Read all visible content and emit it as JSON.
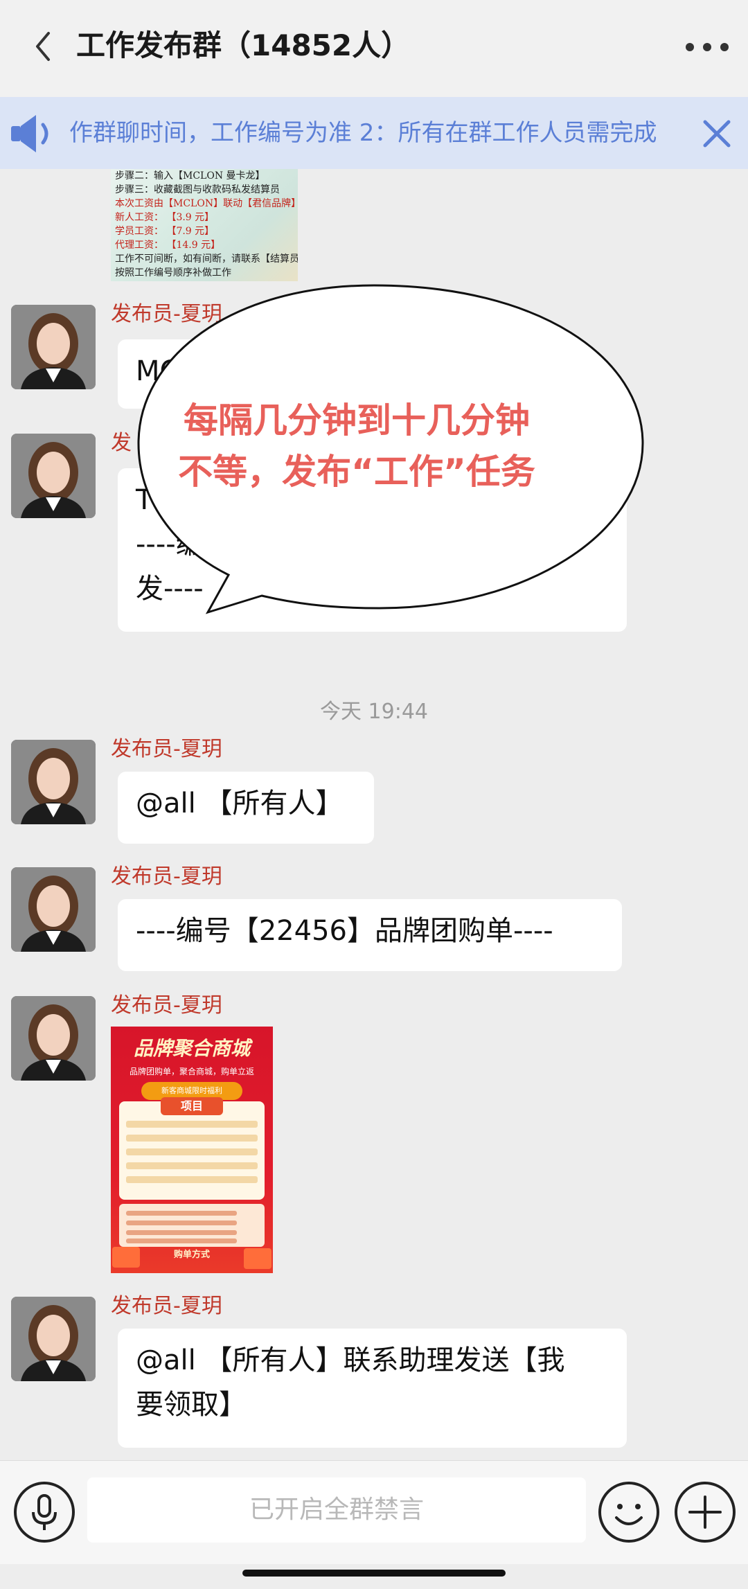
{
  "header": {
    "title": "工作发布群（14852人）"
  },
  "notice": {
    "text": "作群聊时间，工作编号为准 2：所有在群工作人员需完成"
  },
  "steps_image": {
    "lines": [
      "步骤二：输入【MCLON 曼卡龙】",
      "步骤三：收藏截图与收款码私发结算员",
      "本次工资由【MCLON】联动【君信品牌】发放",
      "新人工资：  【3.9 元】",
      "学员工资：  【7.9 元】",
      "代理工资：  【14.9 元】",
      "工作不可间断，如有间断，请联系【结算员】",
      "按照工作编号顺序补做工作"
    ]
  },
  "messages": {
    "m1": {
      "sender": "发布员-夏玥",
      "text": "MC"
    },
    "m2": {
      "sender": "发",
      "line1": "T",
      "line2": "----编",
      "line3": "发----"
    },
    "timestamp": "今天 19:44",
    "m3": {
      "sender": "发布员-夏玥",
      "text": "@all 【所有人】"
    },
    "m4": {
      "sender": "发布员-夏玥",
      "text": "----编号【22456】品牌团购单----"
    },
    "m5": {
      "sender": "发布员-夏玥"
    },
    "m6": {
      "sender": "发布员-夏玥",
      "line1": "@all 【所有人】联系助理发送【我",
      "line2": "要领取】"
    }
  },
  "poster": {
    "title": "品牌聚合商城",
    "subtitle": "品牌团购单，聚合商城，购单立返",
    "ribbon": "新客商城限时福利",
    "project": "项目",
    "buy": "购单方式"
  },
  "balloon": {
    "line1": "每隔几分钟到十几分钟",
    "line2": "不等，发布“工作”任务"
  },
  "input": {
    "placeholder": "已开启全群禁言"
  },
  "colors": {
    "sender": "#c0392b",
    "notice_text": "#5b7fd6",
    "notice_bg": "#dbe4f6",
    "balloon_text": "#e8605a"
  }
}
